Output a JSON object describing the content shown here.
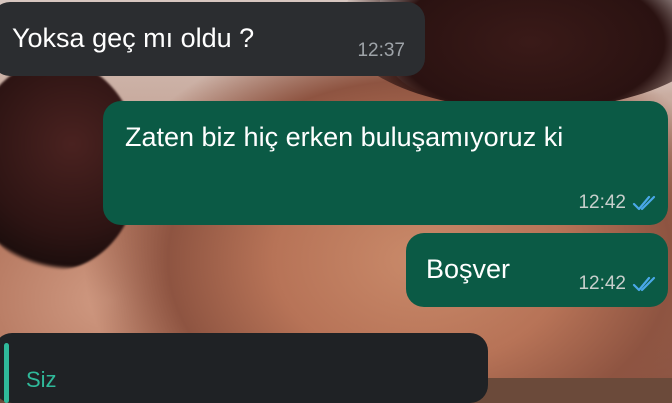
{
  "messages": [
    {
      "text": "Yoksa geç mı oldu ?",
      "time": "12:37",
      "direction": "incoming"
    },
    {
      "text": "Zaten biz hiç erken buluşamıyoruz ki",
      "time": "12:42",
      "direction": "outgoing",
      "status": "read"
    },
    {
      "text": "Boşver",
      "time": "12:42",
      "direction": "outgoing",
      "status": "read"
    }
  ],
  "reply_preview": {
    "author": "Siz"
  },
  "colors": {
    "incoming_bubble": "#2b2d30",
    "outgoing_bubble": "#0b5a45",
    "read_ticks": "#4aa8e8",
    "quote_accent": "#2fb99a"
  }
}
